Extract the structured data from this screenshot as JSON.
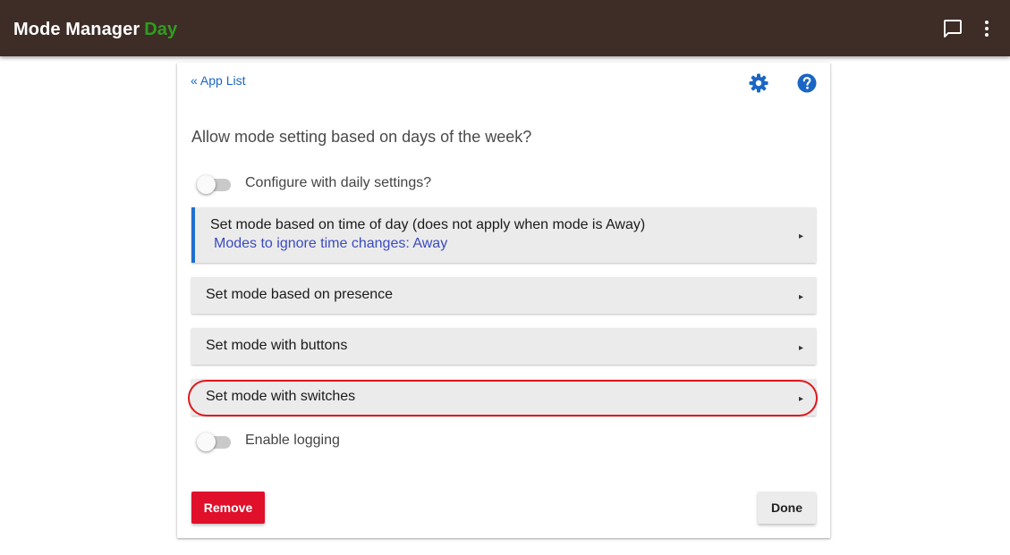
{
  "header": {
    "app_name": "Mode Manager",
    "current_mode": "Day",
    "icons": [
      "chat-icon",
      "more-vert-icon"
    ]
  },
  "nav": {
    "back_link": "« App List"
  },
  "toolbar_icons": [
    "gear-icon",
    "help-icon"
  ],
  "main": {
    "question": "Allow mode setting based on days of the week?",
    "toggles": [
      {
        "label": "Configure with daily settings?",
        "on": false
      },
      {
        "label": "Enable logging",
        "on": false
      }
    ],
    "sections": [
      {
        "title": "Set mode based on time of day (does not apply when mode is Away)",
        "subtitle": "Modes to ignore time changes: Away",
        "arrow": "▸"
      },
      {
        "title": "Set mode based on presence",
        "arrow": "▸"
      },
      {
        "title": "Set mode with buttons",
        "arrow": "▸"
      },
      {
        "title": "Set mode with switches",
        "arrow": "▸"
      }
    ]
  },
  "buttons": {
    "remove": "Remove",
    "done": "Done"
  },
  "colors": {
    "header_bg": "#3e2c27",
    "mode_green": "#2e9e1d",
    "link_blue": "#1a66c4",
    "remove_red": "#e0102a",
    "highlight_red": "#e0161c",
    "active_bar_blue": "#1f6fcf"
  }
}
